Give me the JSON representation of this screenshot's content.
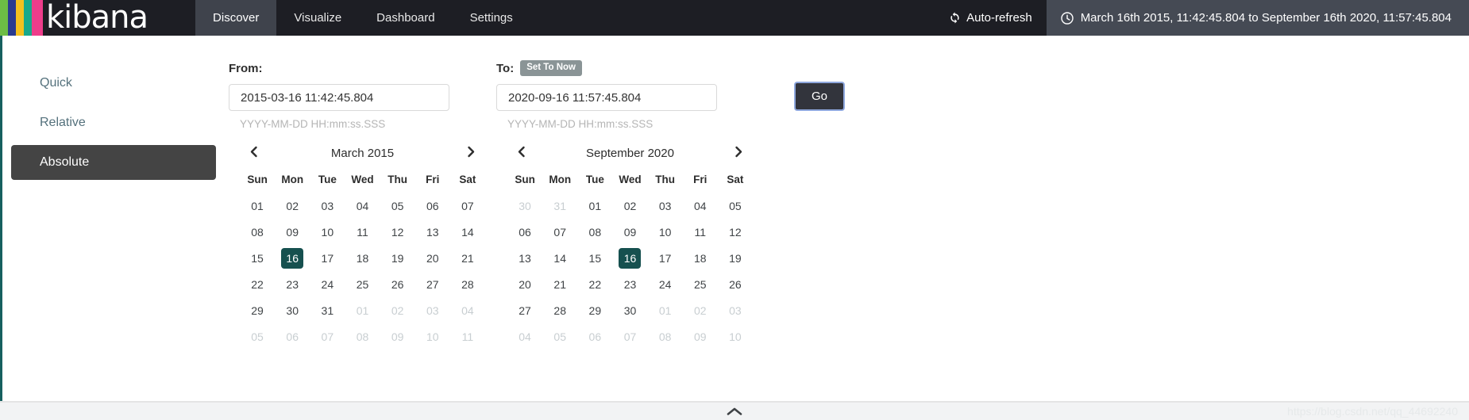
{
  "header": {
    "brand": "kibana",
    "logo_colors": [
      "#6cbd45",
      "#2a3b8f",
      "#f4c11e",
      "#19a98a",
      "#ee3d8b"
    ],
    "tabs": [
      {
        "label": "Discover",
        "active": true
      },
      {
        "label": "Visualize",
        "active": false
      },
      {
        "label": "Dashboard",
        "active": false
      },
      {
        "label": "Settings",
        "active": false
      }
    ],
    "auto_refresh_label": "Auto-refresh",
    "auto_refresh_icon": "refresh-icon",
    "time_range_label": "March 16th 2015, 11:42:45.804 to September 16th 2020, 11:57:45.804",
    "time_range_icon": "clock-icon",
    "background": "#1d1e24",
    "active_tab_background": "#3f434c",
    "timepicker_background": "#454a54"
  },
  "modes": [
    {
      "label": "Quick",
      "active": false
    },
    {
      "label": "Relative",
      "active": false
    },
    {
      "label": "Absolute",
      "active": true
    }
  ],
  "form": {
    "from_label": "From:",
    "from_value": "2015-03-16 11:42:45.804",
    "from_placeholder": "YYYY-MM-DD HH:mm:ss.SSS",
    "to_label": "To:",
    "to_value": "2020-09-16 11:57:45.804",
    "to_placeholder": "YYYY-MM-DD HH:mm:ss.SSS",
    "set_to_now_label": "Set To Now",
    "format_hint": "YYYY-MM-DD HH:mm:ss.SSS",
    "go_label": "Go",
    "accent_color": "#16605f",
    "selected_day_color": "#16504f"
  },
  "calendars": [
    {
      "title": "March 2015",
      "prev_icon": "chevron-left-icon",
      "next_icon": "chevron-right-icon",
      "weekdays": [
        "Sun",
        "Mon",
        "Tue",
        "Wed",
        "Thu",
        "Fri",
        "Sat"
      ],
      "weeks": [
        [
          {
            "d": "01",
            "muted": false
          },
          {
            "d": "02",
            "muted": false
          },
          {
            "d": "03",
            "muted": false
          },
          {
            "d": "04",
            "muted": false
          },
          {
            "d": "05",
            "muted": false
          },
          {
            "d": "06",
            "muted": false
          },
          {
            "d": "07",
            "muted": false
          }
        ],
        [
          {
            "d": "08",
            "muted": false
          },
          {
            "d": "09",
            "muted": false
          },
          {
            "d": "10",
            "muted": false
          },
          {
            "d": "11",
            "muted": false
          },
          {
            "d": "12",
            "muted": false
          },
          {
            "d": "13",
            "muted": false
          },
          {
            "d": "14",
            "muted": false
          }
        ],
        [
          {
            "d": "15",
            "muted": false
          },
          {
            "d": "16",
            "muted": false,
            "selected": true
          },
          {
            "d": "17",
            "muted": false
          },
          {
            "d": "18",
            "muted": false
          },
          {
            "d": "19",
            "muted": false
          },
          {
            "d": "20",
            "muted": false
          },
          {
            "d": "21",
            "muted": false
          }
        ],
        [
          {
            "d": "22",
            "muted": false
          },
          {
            "d": "23",
            "muted": false
          },
          {
            "d": "24",
            "muted": false
          },
          {
            "d": "25",
            "muted": false
          },
          {
            "d": "26",
            "muted": false
          },
          {
            "d": "27",
            "muted": false
          },
          {
            "d": "28",
            "muted": false
          }
        ],
        [
          {
            "d": "29",
            "muted": false
          },
          {
            "d": "30",
            "muted": false
          },
          {
            "d": "31",
            "muted": false
          },
          {
            "d": "01",
            "muted": true
          },
          {
            "d": "02",
            "muted": true
          },
          {
            "d": "03",
            "muted": true
          },
          {
            "d": "04",
            "muted": true
          }
        ],
        [
          {
            "d": "05",
            "muted": true
          },
          {
            "d": "06",
            "muted": true
          },
          {
            "d": "07",
            "muted": true
          },
          {
            "d": "08",
            "muted": true
          },
          {
            "d": "09",
            "muted": true
          },
          {
            "d": "10",
            "muted": true
          },
          {
            "d": "11",
            "muted": true
          }
        ]
      ]
    },
    {
      "title": "September 2020",
      "prev_icon": "chevron-left-icon",
      "next_icon": "chevron-right-icon",
      "weekdays": [
        "Sun",
        "Mon",
        "Tue",
        "Wed",
        "Thu",
        "Fri",
        "Sat"
      ],
      "weeks": [
        [
          {
            "d": "30",
            "muted": true
          },
          {
            "d": "31",
            "muted": true
          },
          {
            "d": "01",
            "muted": false
          },
          {
            "d": "02",
            "muted": false
          },
          {
            "d": "03",
            "muted": false
          },
          {
            "d": "04",
            "muted": false
          },
          {
            "d": "05",
            "muted": false
          }
        ],
        [
          {
            "d": "06",
            "muted": false
          },
          {
            "d": "07",
            "muted": false
          },
          {
            "d": "08",
            "muted": false
          },
          {
            "d": "09",
            "muted": false
          },
          {
            "d": "10",
            "muted": false
          },
          {
            "d": "11",
            "muted": false
          },
          {
            "d": "12",
            "muted": false
          }
        ],
        [
          {
            "d": "13",
            "muted": false
          },
          {
            "d": "14",
            "muted": false
          },
          {
            "d": "15",
            "muted": false
          },
          {
            "d": "16",
            "muted": false,
            "selected": true
          },
          {
            "d": "17",
            "muted": false
          },
          {
            "d": "18",
            "muted": false
          },
          {
            "d": "19",
            "muted": false
          }
        ],
        [
          {
            "d": "20",
            "muted": false
          },
          {
            "d": "21",
            "muted": false
          },
          {
            "d": "22",
            "muted": false
          },
          {
            "d": "23",
            "muted": false
          },
          {
            "d": "24",
            "muted": false
          },
          {
            "d": "25",
            "muted": false
          },
          {
            "d": "26",
            "muted": false
          }
        ],
        [
          {
            "d": "27",
            "muted": false
          },
          {
            "d": "28",
            "muted": false
          },
          {
            "d": "29",
            "muted": false
          },
          {
            "d": "30",
            "muted": false
          },
          {
            "d": "01",
            "muted": true
          },
          {
            "d": "02",
            "muted": true
          },
          {
            "d": "03",
            "muted": true
          }
        ],
        [
          {
            "d": "04",
            "muted": true
          },
          {
            "d": "05",
            "muted": true
          },
          {
            "d": "06",
            "muted": true
          },
          {
            "d": "07",
            "muted": true
          },
          {
            "d": "08",
            "muted": true
          },
          {
            "d": "09",
            "muted": true
          },
          {
            "d": "10",
            "muted": true
          }
        ]
      ]
    }
  ],
  "footer": {
    "collapse_icon": "chevron-up-icon",
    "watermark": "https://blog.csdn.net/qq_44692240"
  }
}
